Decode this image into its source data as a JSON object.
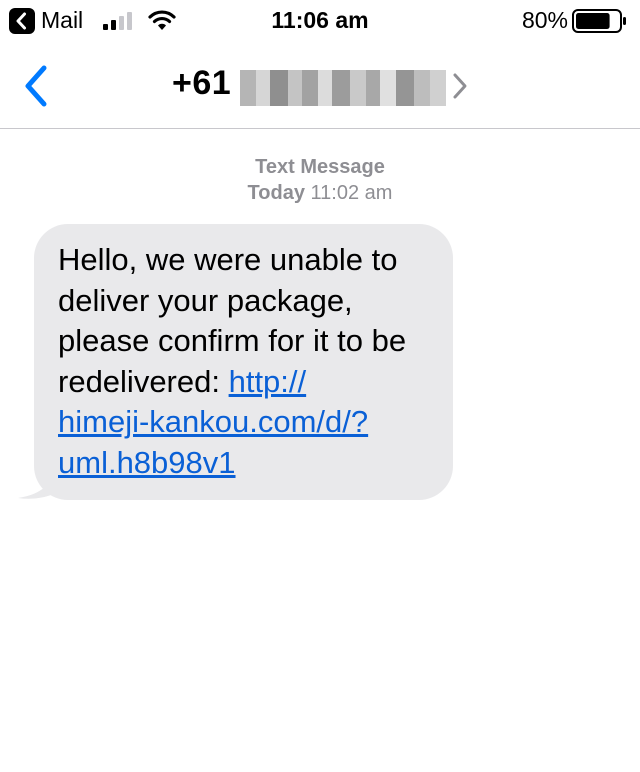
{
  "status_bar": {
    "back_app": "Mail",
    "time": "11:06 am",
    "battery_percent": "80%",
    "battery_level": 0.8,
    "signal_bars": 2
  },
  "nav": {
    "contact_prefix": "+61"
  },
  "header": {
    "type": "Text Message",
    "day": "Today",
    "time": "11:02 am"
  },
  "message": {
    "text": "Hello, we were unable to deliver your package, please confirm for it to be redelivered: ",
    "link": "http://himeji-kankou.com/d/?uml.h8b98v1"
  },
  "colors": {
    "accent": "#007aff",
    "link": "#0a60d6",
    "bubble": "#e9e9eb",
    "meta": "#8e8e93"
  }
}
